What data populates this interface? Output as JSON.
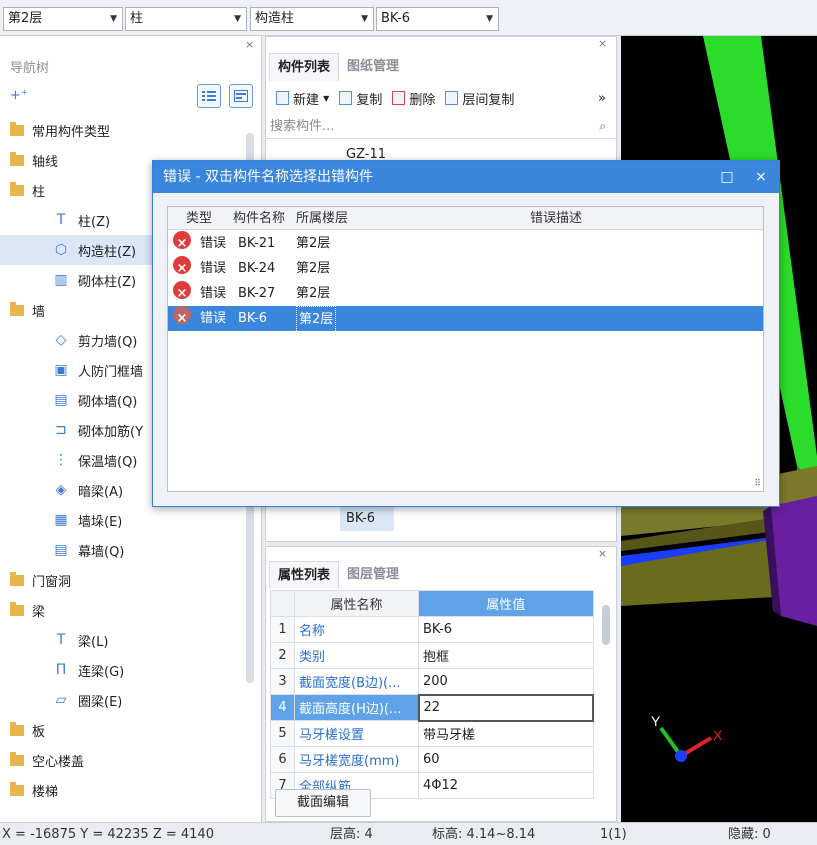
{
  "toolbar": {
    "floor": "第2层",
    "category": "柱",
    "type": "构造柱",
    "component": "BK-6"
  },
  "nav": {
    "title": "导航树",
    "close": "×",
    "items": [
      {
        "label": "常用构件类型",
        "level": 0
      },
      {
        "label": "轴线",
        "level": 0
      },
      {
        "label": "柱",
        "level": 0
      },
      {
        "label": "柱(Z)",
        "level": 1
      },
      {
        "label": "构造柱(Z)",
        "level": 1,
        "selected": true
      },
      {
        "label": "砌体柱(Z)",
        "level": 1
      },
      {
        "label": "墙",
        "level": 0
      },
      {
        "label": "剪力墙(Q)",
        "level": 1
      },
      {
        "label": "人防门框墙",
        "level": 1
      },
      {
        "label": "砌体墙(Q)",
        "level": 1
      },
      {
        "label": "砌体加筋(Y",
        "level": 1
      },
      {
        "label": "保温墙(Q)",
        "level": 1
      },
      {
        "label": "暗梁(A)",
        "level": 1
      },
      {
        "label": "墙垛(E)",
        "level": 1
      },
      {
        "label": "幕墙(Q)",
        "level": 1
      },
      {
        "label": "门窗洞",
        "level": 0
      },
      {
        "label": "梁",
        "level": 0
      },
      {
        "label": "梁(L)",
        "level": 1
      },
      {
        "label": "连梁(G)",
        "level": 1
      },
      {
        "label": "圈梁(E)",
        "level": 1
      },
      {
        "label": "板",
        "level": 0
      },
      {
        "label": "空心楼盖",
        "level": 0
      },
      {
        "label": "楼梯",
        "level": 0
      }
    ]
  },
  "component_panel": {
    "close": "×",
    "tabs": [
      "构件列表",
      "图纸管理"
    ],
    "tools": {
      "new": "新建",
      "copy": "复制",
      "delete": "删除",
      "floor_copy": "层间复制",
      "more": "»"
    },
    "search_placeholder": "搜索构件...",
    "partial_item": "GZ-11",
    "selected_item": "BK-6"
  },
  "property_panel": {
    "close": "×",
    "tabs": [
      "属性列表",
      "图层管理"
    ],
    "header_name": "属性名称",
    "header_value": "属性值",
    "rows": [
      {
        "num": "1",
        "name": "名称",
        "value": "BK-6"
      },
      {
        "num": "2",
        "name": "类别",
        "value": "抱框"
      },
      {
        "num": "3",
        "name": "截面宽度(B边)(...",
        "value": "200"
      },
      {
        "num": "4",
        "name": "截面高度(H边)(...",
        "value": "22"
      },
      {
        "num": "5",
        "name": "马牙槎设置",
        "value": "带马牙槎"
      },
      {
        "num": "6",
        "name": "马牙槎宽度(mm)",
        "value": "60"
      },
      {
        "num": "7",
        "name": "全部纵筋",
        "value": "4Φ12"
      }
    ],
    "section_edit_button": "截面编辑"
  },
  "dialog": {
    "title": "错误 - 双击构件名称选择出错构件",
    "maximize": "□",
    "close": "×",
    "columns": [
      "类型",
      "构件名称",
      "所属楼层",
      "错误描述"
    ],
    "rows": [
      {
        "type": "错误",
        "name": "BK-21",
        "floor": "第2层",
        "desc": ""
      },
      {
        "type": "错误",
        "name": "BK-24",
        "floor": "第2层",
        "desc": ""
      },
      {
        "type": "错误",
        "name": "BK-27",
        "floor": "第2层",
        "desc": ""
      },
      {
        "type": "错误",
        "name": "BK-6",
        "floor": "第2层",
        "desc": "",
        "selected": true
      }
    ]
  },
  "status": {
    "coords": "X = -16875 Y = 42235 Z = 4140",
    "floor_height": "层高:  4",
    "elevation": "标高:  4.14~8.14",
    "count": "1(1)",
    "hidden": "隐藏:  0"
  },
  "axes": {
    "x": "X",
    "y": "Y"
  },
  "colors": {
    "accent": "#3a86dd",
    "error": "#e23b3b",
    "green_beam": "#2bdc2b",
    "olive_beam": "#7a7a2a",
    "blue_beam": "#1a3dff",
    "purple_beam": "#6a1fa0"
  }
}
